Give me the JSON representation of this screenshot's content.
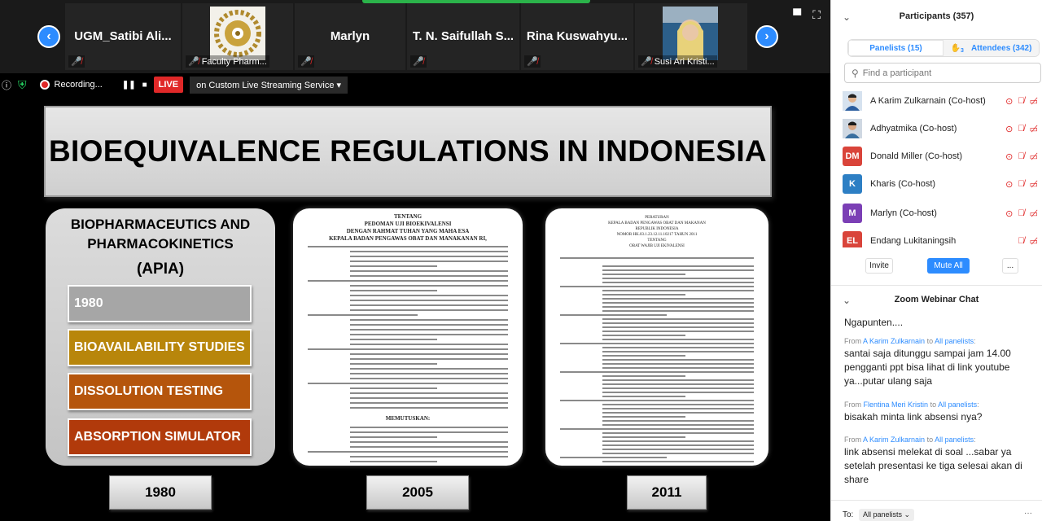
{
  "gallery": {
    "tiles": [
      {
        "name": "UGM_Satibi Ali...",
        "label": ""
      },
      {
        "name": "",
        "label": "Faculty Pharm..."
      },
      {
        "name": "Marlyn",
        "label": ""
      },
      {
        "name": "T. N. Saifullah S...",
        "label": ""
      },
      {
        "name": "Rina Kuswahyu...",
        "label": ""
      },
      {
        "name": "",
        "label": "Susi Ari Kristi..."
      }
    ]
  },
  "status": {
    "recording": "Recording...",
    "live": "LIVE",
    "service": "on Custom Live Streaming Service"
  },
  "slide": {
    "title": "BIOEQUIVALENCE REGULATIONS IN  INDONESIA",
    "col1_heading_line1": "BIOPHARMACEUTICS AND",
    "col1_heading_line2": "PHARMACOKINETICS",
    "col1_sub": "(APIA)",
    "bars": [
      {
        "label": "1980",
        "color": "#a6a6a6"
      },
      {
        "label": "BIOAVAILABILITY STUDIES",
        "color": "#b8860b"
      },
      {
        "label": "DISSOLUTION TESTING",
        "color": "#b5550c"
      },
      {
        "label": "ABSORPTION SIMULATOR",
        "color": "#b13a0b"
      }
    ],
    "years": [
      "1980",
      "2005",
      "2011"
    ],
    "doc2005_head": "TENTANG\nPEDOMAN UJI BIOEKIVALENSI\nDENGAN RAHMAT TUHAN YANG MAHA ESA\nKEPALA BADAN PENGAWAS OBAT DAN MANAKANAN RI,",
    "doc2005_mid": "MEMUTUSKAN:",
    "doc2011_head": "PERATURAN\nKEPALA BADAN PENGAWAS OBAT DAN MAKANAN\nREPUBLIK INDONESIA\nNOMOR HK.03.1.23.12.11.10217 TAHUN 2011\nTENTANG\nOBAT WAJIB UJI EKIVALENSI"
  },
  "participants": {
    "title": "Participants (357)",
    "panelists_tab": "Panelists (15)",
    "attendees_tab": "Attendees (342)",
    "raised_count": "3",
    "search_placeholder": "Find a participant",
    "list": [
      {
        "name": "A Karim Zulkarnain (Co-host)",
        "initials": "",
        "color": "#2a5d9f"
      },
      {
        "name": "Adhyatmika (Co-host)",
        "initials": "",
        "color": "#3a6f9f"
      },
      {
        "name": "Donald Miller (Co-host)",
        "initials": "DM",
        "color": "#d9443a"
      },
      {
        "name": "Kharis (Co-host)",
        "initials": "K",
        "color": "#2d7fc4"
      },
      {
        "name": "Marlyn (Co-host)",
        "initials": "M",
        "color": "#7b3fb5"
      },
      {
        "name": "Endang Lukitaningsih",
        "initials": "EL",
        "color": "#d9443a"
      }
    ],
    "invite": "Invite",
    "mute_all": "Mute All",
    "more": "..."
  },
  "chat": {
    "title": "Zoom Webinar Chat",
    "messages": [
      {
        "from": "",
        "to": "",
        "text": "Ngapunten...."
      },
      {
        "from": "A Karim Zulkarnain",
        "to": "All panelists",
        "text": "santai saja ditunggu sampai jam 14.00 pengganti ppt bisa lihat di link youtube ya...putar ulang saja"
      },
      {
        "from": "Flentina Meri Kristin",
        "to": "All panelists",
        "text": "bisakah minta link absensi nya?"
      },
      {
        "from": "A Karim Zulkarnain",
        "to": "All panelists",
        "text": "link absensi melekat di soal ...sabar ya setelah presentasi ke tiga selesai akan di share"
      }
    ],
    "from_word": "From",
    "to_word": "to",
    "to_label": "To:",
    "to_value": "All panelists",
    "more": "···"
  }
}
